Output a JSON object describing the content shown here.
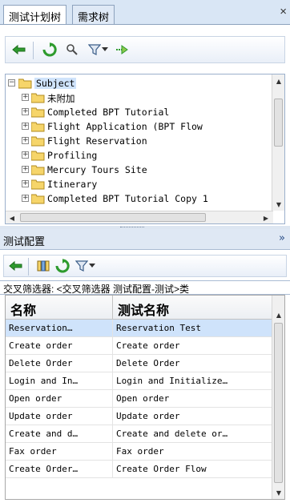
{
  "tabs": [
    {
      "label": "测试计划树",
      "active": true
    },
    {
      "label": "需求树",
      "active": false
    }
  ],
  "tab_close": "×",
  "toolbar1": {
    "icons": [
      "back-arrow-icon",
      "refresh-icon",
      "search-icon",
      "filter-icon",
      "dropdown-arrow-icon",
      "go-to-icon"
    ]
  },
  "tree": {
    "root": "Subject",
    "items": [
      "未附加",
      "Completed BPT Tutorial",
      "Flight Application (BPT Flow",
      "Flight Reservation",
      "Profiling",
      "Mercury Tours Site",
      "Itinerary",
      "Completed BPT Tutorial Copy 1"
    ],
    "expand_symbol": "+",
    "collapse_symbol": "−"
  },
  "panel2": {
    "title": "测试配置",
    "collapse_glyph": "»"
  },
  "toolbar2": {
    "icons": [
      "back-arrow-icon",
      "columns-icon",
      "refresh-icon",
      "filter-icon",
      "dropdown-arrow-icon"
    ]
  },
  "filter_text": "交叉筛选器: <交叉筛选器 测试配置-测试>类",
  "grid": {
    "columns": [
      "名称",
      "测试名称"
    ],
    "rows": [
      [
        "Reservation…",
        "Reservation Test"
      ],
      [
        "Create order",
        "Create order"
      ],
      [
        "Delete Order",
        "Delete Order"
      ],
      [
        "Login and In…",
        "Login and Initialize…"
      ],
      [
        "Open order",
        "Open order"
      ],
      [
        "Update order",
        "Update order"
      ],
      [
        "Create and d…",
        "Create and delete or…"
      ],
      [
        "Fax order",
        "Fax order"
      ],
      [
        "Create Order…",
        "Create Order Flow"
      ]
    ],
    "selected_row": 0
  },
  "colors": {
    "accent_green": "#2e9b2e",
    "selection": "#cfe3fb",
    "panel_header": "#dfe8f4",
    "folder_yellow": "#f6d56a"
  }
}
